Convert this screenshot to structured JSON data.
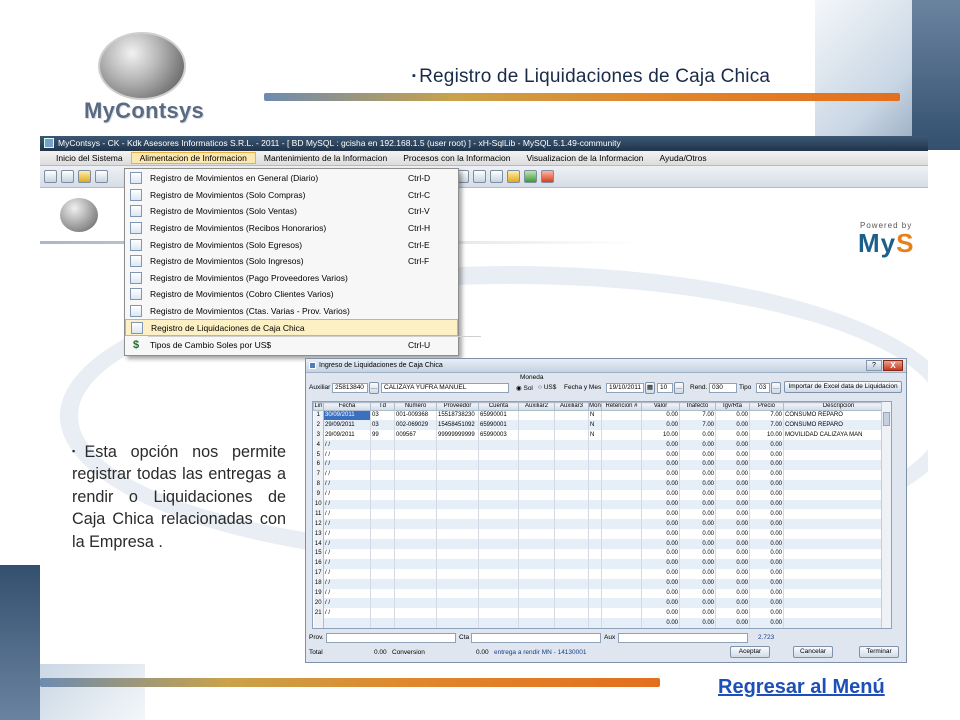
{
  "slide": {
    "logo_text": "MyContsys",
    "title": "Registro de Liquidaciones de Caja Chica",
    "description": "Esta opción nos permite registrar todas las entregas a rendir o Liquidaciones de Caja Chica relacionadas con la Empresa .",
    "bullet": "▪",
    "back_link": "Regresar al Menú"
  },
  "app": {
    "window_title": "MyContsys - CK - Kdk Asesores Informaticos S.R.L. - 2011 - [ BD MySQL : gcisha en 192.168.1.5 (user root) ] - xH-SqlLib - MySQL 5.1.49-community",
    "menu": [
      "Inicio del Sistema",
      "Alimentacion de Informacion",
      "Mantenimiento de la Informacion",
      "Procesos con la Informacion",
      "Visualizacion de la Informacion",
      "Ayuda/Otros"
    ],
    "active_menu_index": 1,
    "powered_by": "Powered by",
    "brand_left": "My",
    "brand_right": "S",
    "dropdown": [
      {
        "label": "Registro de Movimientos en General (Diario)",
        "shortcut": "Ctrl-D",
        "icon": "document-icon"
      },
      {
        "label": "Registro de Movimientos (Solo Compras)",
        "shortcut": "Ctrl-C",
        "icon": "document-icon"
      },
      {
        "label": "Registro de Movimientos (Solo Ventas)",
        "shortcut": "Ctrl-V",
        "icon": "document-icon"
      },
      {
        "label": "Registro de Movimientos (Recibos Honorarios)",
        "shortcut": "Ctrl-H",
        "icon": "document-icon"
      },
      {
        "label": "Registro de Movimientos (Solo Egresos)",
        "shortcut": "Ctrl-E",
        "icon": "document-icon"
      },
      {
        "label": "Registro de Movimientos (Solo Ingresos)",
        "shortcut": "Ctrl-F",
        "icon": "document-icon"
      },
      {
        "label": "Registro de Movimientos (Pago Proveedores Varios)",
        "shortcut": "",
        "icon": "document-icon"
      },
      {
        "label": "Registro de Movimientos (Cobro Clientes Varios)",
        "shortcut": "",
        "icon": "document-icon"
      },
      {
        "label": "Registro de Movimientos (Ctas. Varias - Prov. Varios)",
        "shortcut": "",
        "icon": "document-icon"
      },
      {
        "label": "Registro de Liquidaciones de Caja Chica",
        "shortcut": "",
        "icon": "document-icon"
      },
      {
        "label": "Tipos de Cambio Soles por US$",
        "shortcut": "Ctrl-U",
        "icon": "dollar-icon"
      }
    ],
    "highlighted_index": 9
  },
  "dialog": {
    "title": "Ingreso de Liquidaciones de Caja Chica",
    "help": "?",
    "close": "X",
    "auxiliar_label": "Auxiliar",
    "auxiliar_code": "25813840",
    "auxiliar_name": "CALIZAYA YUFRA MANUEL",
    "moneda_label": "Moneda",
    "sol_label": "Sol",
    "usd_label": "US$",
    "fecha_mes_label": "Fecha y Mes",
    "fecha_value": "19/10/2011",
    "mes_value": "10",
    "rend_label": "Rend.",
    "rend_value": "030",
    "tipo_label": "Tipo",
    "tipo_value": "03",
    "import_button": "Importar de Excel data de Liquidacion",
    "columns": [
      "Lin",
      "Fecha",
      "Td",
      "Numero",
      "Proveedor",
      "Cuenta",
      "Auxiliar2",
      "Auxiliar3",
      "Mon",
      "Retencion #",
      "Valor",
      "Inafecto",
      "Igv/Rta",
      "Precio",
      "Descripcion"
    ],
    "rows": [
      {
        "lin": "1",
        "fecha": "30/09/2011",
        "td": "03",
        "numero": "001-009368",
        "proveedor": "15518738230",
        "cuenta": "65990001",
        "aux2": "",
        "aux3": "",
        "mon": "N",
        "ret": "",
        "valor": "0.00",
        "inafecto": "7.00",
        "igv": "0.00",
        "precio": "7.00",
        "desc": "CONSUMO REPARO"
      },
      {
        "lin": "2",
        "fecha": "29/09/2011",
        "td": "03",
        "numero": "002-069029",
        "proveedor": "15458451092",
        "cuenta": "65990001",
        "aux2": "",
        "aux3": "",
        "mon": "N",
        "ret": "",
        "valor": "0.00",
        "inafecto": "7.00",
        "igv": "0.00",
        "precio": "7.00",
        "desc": "CONSUMO REPARO"
      },
      {
        "lin": "3",
        "fecha": "29/09/2011",
        "td": "99",
        "numero": "009567",
        "proveedor": "99999999999",
        "cuenta": "65990003",
        "aux2": "",
        "aux3": "",
        "mon": "N",
        "ret": "",
        "valor": "10.00",
        "inafecto": "0.00",
        "igv": "0.00",
        "precio": "10.00",
        "desc": "MOVILIDAD CALIZAYA MAN"
      },
      {
        "lin": "4",
        "fecha": " / /",
        "td": "",
        "numero": "",
        "proveedor": "",
        "cuenta": "",
        "aux2": "",
        "aux3": "",
        "mon": "",
        "ret": "",
        "valor": "0.00",
        "inafecto": "0.00",
        "igv": "0.00",
        "precio": "0.00",
        "desc": ""
      },
      {
        "lin": "5",
        "fecha": " / /",
        "td": "",
        "numero": "",
        "proveedor": "",
        "cuenta": "",
        "aux2": "",
        "aux3": "",
        "mon": "",
        "ret": "",
        "valor": "0.00",
        "inafecto": "0.00",
        "igv": "0.00",
        "precio": "0.00",
        "desc": ""
      },
      {
        "lin": "6",
        "fecha": " / /",
        "td": "",
        "numero": "",
        "proveedor": "",
        "cuenta": "",
        "aux2": "",
        "aux3": "",
        "mon": "",
        "ret": "",
        "valor": "0.00",
        "inafecto": "0.00",
        "igv": "0.00",
        "precio": "0.00",
        "desc": ""
      },
      {
        "lin": "7",
        "fecha": " / /",
        "td": "",
        "numero": "",
        "proveedor": "",
        "cuenta": "",
        "aux2": "",
        "aux3": "",
        "mon": "",
        "ret": "",
        "valor": "0.00",
        "inafecto": "0.00",
        "igv": "0.00",
        "precio": "0.00",
        "desc": ""
      },
      {
        "lin": "8",
        "fecha": " / /",
        "td": "",
        "numero": "",
        "proveedor": "",
        "cuenta": "",
        "aux2": "",
        "aux3": "",
        "mon": "",
        "ret": "",
        "valor": "0.00",
        "inafecto": "0.00",
        "igv": "0.00",
        "precio": "0.00",
        "desc": ""
      },
      {
        "lin": "9",
        "fecha": " / /",
        "td": "",
        "numero": "",
        "proveedor": "",
        "cuenta": "",
        "aux2": "",
        "aux3": "",
        "mon": "",
        "ret": "",
        "valor": "0.00",
        "inafecto": "0.00",
        "igv": "0.00",
        "precio": "0.00",
        "desc": ""
      },
      {
        "lin": "10",
        "fecha": " / /",
        "td": "",
        "numero": "",
        "proveedor": "",
        "cuenta": "",
        "aux2": "",
        "aux3": "",
        "mon": "",
        "ret": "",
        "valor": "0.00",
        "inafecto": "0.00",
        "igv": "0.00",
        "precio": "0.00",
        "desc": ""
      },
      {
        "lin": "11",
        "fecha": " / /",
        "td": "",
        "numero": "",
        "proveedor": "",
        "cuenta": "",
        "aux2": "",
        "aux3": "",
        "mon": "",
        "ret": "",
        "valor": "0.00",
        "inafecto": "0.00",
        "igv": "0.00",
        "precio": "0.00",
        "desc": ""
      },
      {
        "lin": "12",
        "fecha": " / /",
        "td": "",
        "numero": "",
        "proveedor": "",
        "cuenta": "",
        "aux2": "",
        "aux3": "",
        "mon": "",
        "ret": "",
        "valor": "0.00",
        "inafecto": "0.00",
        "igv": "0.00",
        "precio": "0.00",
        "desc": ""
      },
      {
        "lin": "13",
        "fecha": " / /",
        "td": "",
        "numero": "",
        "proveedor": "",
        "cuenta": "",
        "aux2": "",
        "aux3": "",
        "mon": "",
        "ret": "",
        "valor": "0.00",
        "inafecto": "0.00",
        "igv": "0.00",
        "precio": "0.00",
        "desc": ""
      },
      {
        "lin": "14",
        "fecha": " / /",
        "td": "",
        "numero": "",
        "proveedor": "",
        "cuenta": "",
        "aux2": "",
        "aux3": "",
        "mon": "",
        "ret": "",
        "valor": "0.00",
        "inafecto": "0.00",
        "igv": "0.00",
        "precio": "0.00",
        "desc": ""
      },
      {
        "lin": "15",
        "fecha": " / /",
        "td": "",
        "numero": "",
        "proveedor": "",
        "cuenta": "",
        "aux2": "",
        "aux3": "",
        "mon": "",
        "ret": "",
        "valor": "0.00",
        "inafecto": "0.00",
        "igv": "0.00",
        "precio": "0.00",
        "desc": ""
      },
      {
        "lin": "16",
        "fecha": " / /",
        "td": "",
        "numero": "",
        "proveedor": "",
        "cuenta": "",
        "aux2": "",
        "aux3": "",
        "mon": "",
        "ret": "",
        "valor": "0.00",
        "inafecto": "0.00",
        "igv": "0.00",
        "precio": "0.00",
        "desc": ""
      },
      {
        "lin": "17",
        "fecha": " / /",
        "td": "",
        "numero": "",
        "proveedor": "",
        "cuenta": "",
        "aux2": "",
        "aux3": "",
        "mon": "",
        "ret": "",
        "valor": "0.00",
        "inafecto": "0.00",
        "igv": "0.00",
        "precio": "0.00",
        "desc": ""
      },
      {
        "lin": "18",
        "fecha": " / /",
        "td": "",
        "numero": "",
        "proveedor": "",
        "cuenta": "",
        "aux2": "",
        "aux3": "",
        "mon": "",
        "ret": "",
        "valor": "0.00",
        "inafecto": "0.00",
        "igv": "0.00",
        "precio": "0.00",
        "desc": ""
      },
      {
        "lin": "19",
        "fecha": " / /",
        "td": "",
        "numero": "",
        "proveedor": "",
        "cuenta": "",
        "aux2": "",
        "aux3": "",
        "mon": "",
        "ret": "",
        "valor": "0.00",
        "inafecto": "0.00",
        "igv": "0.00",
        "precio": "0.00",
        "desc": ""
      },
      {
        "lin": "20",
        "fecha": " / /",
        "td": "",
        "numero": "",
        "proveedor": "",
        "cuenta": "",
        "aux2": "",
        "aux3": "",
        "mon": "",
        "ret": "",
        "valor": "0.00",
        "inafecto": "0.00",
        "igv": "0.00",
        "precio": "0.00",
        "desc": ""
      },
      {
        "lin": "21",
        "fecha": " / /",
        "td": "",
        "numero": "",
        "proveedor": "",
        "cuenta": "",
        "aux2": "",
        "aux3": "",
        "mon": "",
        "ret": "",
        "valor": "0.00",
        "inafecto": "0.00",
        "igv": "0.00",
        "precio": "0.00",
        "desc": ""
      },
      {
        "lin": "",
        "fecha": "",
        "td": "",
        "numero": "",
        "proveedor": "",
        "cuenta": "",
        "aux2": "",
        "aux3": "",
        "mon": "",
        "ret": "",
        "valor": "0.00",
        "inafecto": "0.00",
        "igv": "0.00",
        "precio": "0.00",
        "desc": ""
      }
    ],
    "selected_row_index": 0,
    "prov_label": "Prov.",
    "cta_label": "Cta",
    "aux_label": "Aux",
    "total_aux": "2.723",
    "total_label": "Total",
    "total_value": "0.00",
    "conversion_label": "Conversion",
    "conversion_value": "0.00",
    "entrega_text": "entrega a rendir MN - 14130001",
    "accept_button": "Aceptar",
    "cancel_button": "Cancelar",
    "finish_button": "Terminar"
  }
}
